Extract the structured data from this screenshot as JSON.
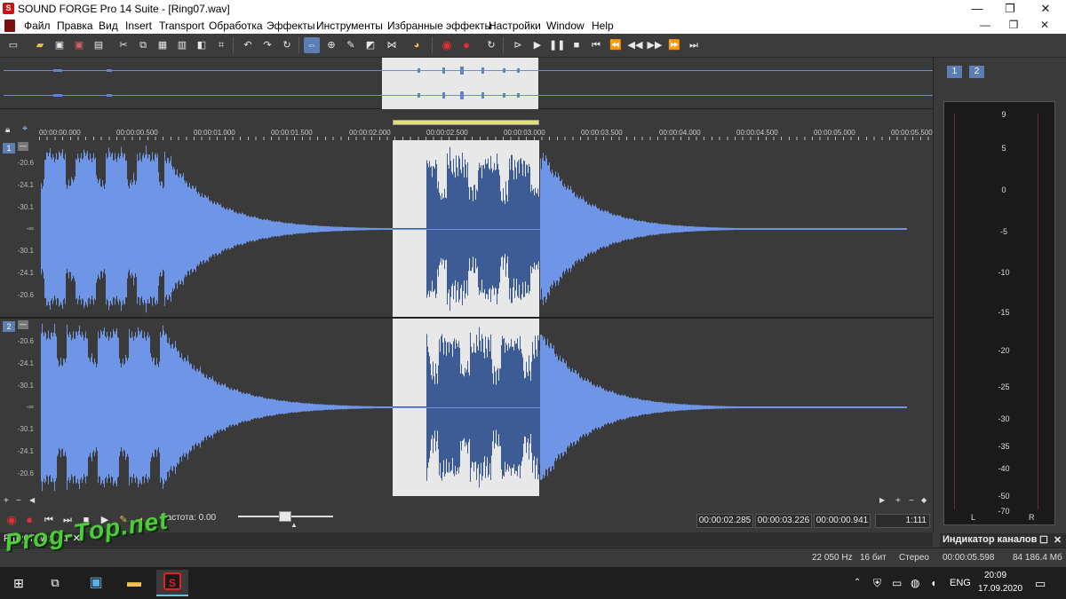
{
  "window": {
    "title": "SOUND FORGE Pro 14 Suite - [Ring07.wav]",
    "app_logo": "S",
    "minimize": "—",
    "maximize": "❐",
    "close": "✕"
  },
  "menu": {
    "items": [
      "Файл",
      "Правка",
      "Вид",
      "Insert",
      "Transport",
      "Обработка",
      "Эффекты",
      "Инструменты",
      "Избранные эффекты",
      "Настройки",
      "Window",
      "Help"
    ],
    "mdi_minimize": "—",
    "mdi_restore": "❐",
    "mdi_close": "✕"
  },
  "ruler": {
    "labels": [
      "00:00:00.000",
      "00:00:00.500",
      "00:00:01.000",
      "00:00:01.500",
      "00:00:02.000",
      "00:00:02.500",
      "00:00:03.000",
      "00:00:03.500",
      "00:00:04.000",
      "00:00:04.500",
      "00:00:05.000",
      "00:00:05.500"
    ]
  },
  "channels": [
    {
      "number": "1",
      "db_labels": [
        "-20.6",
        "-24.1",
        "-30.1",
        "-∞",
        "-30.1",
        "-24.1",
        "-20.6"
      ]
    },
    {
      "number": "2",
      "db_labels": [
        "-20.6",
        "-24.1",
        "-30.1",
        "-∞",
        "-30.1",
        "-24.1",
        "-20.6"
      ]
    }
  ],
  "transport": {
    "frequency_label": "Частота: 0.00",
    "selection_start": "00:00:02.285",
    "selection_end": "00:00:03.226",
    "selection_length": "00:00:00.941",
    "zoom_ratio": "1:111"
  },
  "document_tab": {
    "label": "Ring07.wav",
    "restore": "⧉",
    "close": "✕"
  },
  "meter": {
    "tabs": [
      "1",
      "2"
    ],
    "scale": [
      "9",
      "5",
      "0",
      "-5",
      "-10",
      "-15",
      "-20",
      "-25",
      "-30",
      "-35",
      "-40",
      "-50",
      "-70"
    ],
    "channel_labels": [
      "L",
      "R"
    ],
    "panel_title": "Индикатор каналов",
    "panel_restore": "☐",
    "panel_close": "✕"
  },
  "status": {
    "sample_rate": "22 050 Hz",
    "bit_depth": "16 бит",
    "channels": "Стерео",
    "duration": "00:00:05.598",
    "free_space": "84 186.4 Мб"
  },
  "taskbar": {
    "language": "ENG",
    "time": "20:09",
    "date": "17.09.2020"
  },
  "watermark": "Prog-Top.net",
  "colors": {
    "waveform": "#6f95e6",
    "waveform_selected": "#3d5b94",
    "selection_bg": "#e8e8e8",
    "accent": "#5b7fb5",
    "record": "#e23030"
  }
}
